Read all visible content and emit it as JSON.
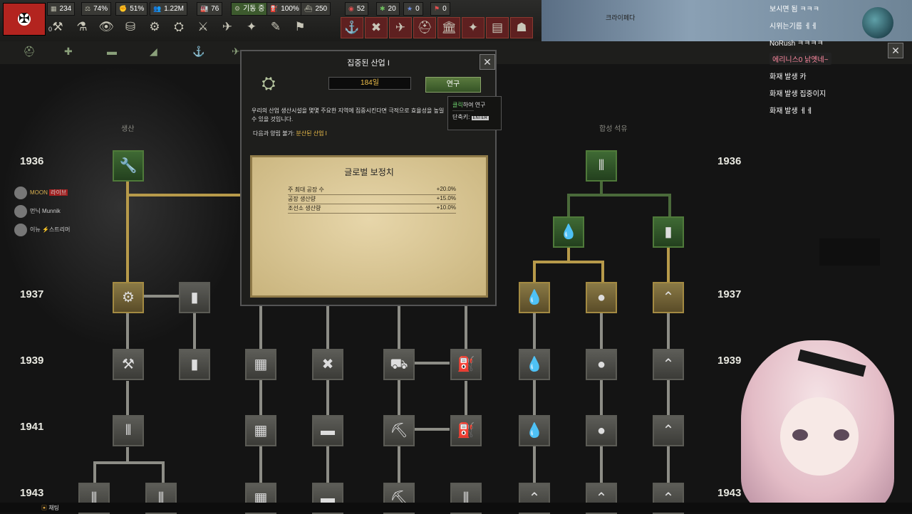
{
  "topbar": {
    "resources": [
      {
        "icon": "stack-icon",
        "value": "234"
      },
      {
        "icon": "stability-icon",
        "value": "74%"
      },
      {
        "icon": "warsupport-icon",
        "value": "51%"
      },
      {
        "icon": "manpower-icon",
        "value": "1.22M"
      },
      {
        "icon": "factory-icon",
        "value": "76"
      },
      {
        "icon": "mobilization-icon",
        "value": "기동 중",
        "green": true
      },
      {
        "icon": "fuel-icon",
        "value": "100%"
      },
      {
        "icon": "convoy-icon",
        "value": "250"
      },
      {
        "icon": "alert-icon",
        "value": "52"
      },
      {
        "icon": "star-icon",
        "value": "20"
      },
      {
        "icon": "navy-star-icon",
        "value": "0"
      },
      {
        "icon": "flag-icon",
        "value": "0"
      }
    ],
    "flag_number": "0",
    "map_label": "크라이페다"
  },
  "tabs_sub": [
    "infantry-tab",
    "support-tab",
    "armor-tab",
    "artillery-tab",
    "naval-tab",
    "air-tab"
  ],
  "columns": {
    "production": "생산",
    "synthetic": "합성 석유"
  },
  "years": [
    "1936",
    "1937",
    "1939",
    "1941",
    "1943"
  ],
  "roster": [
    {
      "name": "라이브",
      "tag": "MOON"
    },
    {
      "name": "먼닉 Munnik"
    },
    {
      "name": "이뉴 ⚡스트리머"
    }
  ],
  "dialog": {
    "title": "집중된 산업 I",
    "days": "184일",
    "research_btn": "연구",
    "description": "우리의 산업 생산시설을 몇몇 주요한 지역에 집중시킨다면 극적으로 효율성을 높일 수 있을 것입니다.",
    "exclusive_label": "다음과 양립 불가:",
    "exclusive_value": "분산된 산업 I",
    "panel_title": "글로벌 보정치",
    "modifiers": [
      {
        "label": "주 최대 공장 수",
        "value": "+20.0%"
      },
      {
        "label": "공장 생산량",
        "value": "+15.0%"
      },
      {
        "label": "조선소 생산량",
        "value": "+10.0%"
      }
    ]
  },
  "tooltip": {
    "click_word": "클릭",
    "click_rest": "하여 연구",
    "divider": "---------------",
    "shortcut_label": "단축키:",
    "shortcut_key": "ENTER"
  },
  "chat": [
    {
      "text": "보시면 됨 ㅋㅋㅋ"
    },
    {
      "text": "시위는기름 ㅔㅔ"
    },
    {
      "text": "NoRush ㅋㅋㅋㅋ"
    },
    {
      "text": "에리니스0 낡옛네~",
      "highlight": true
    },
    {
      "text": "화재 발생 카"
    },
    {
      "text": "화재 발생 집중이지"
    },
    {
      "text": "화재 발생 ㅔㅔ"
    }
  ],
  "statusbar": {
    "chat_label": "채팅"
  }
}
